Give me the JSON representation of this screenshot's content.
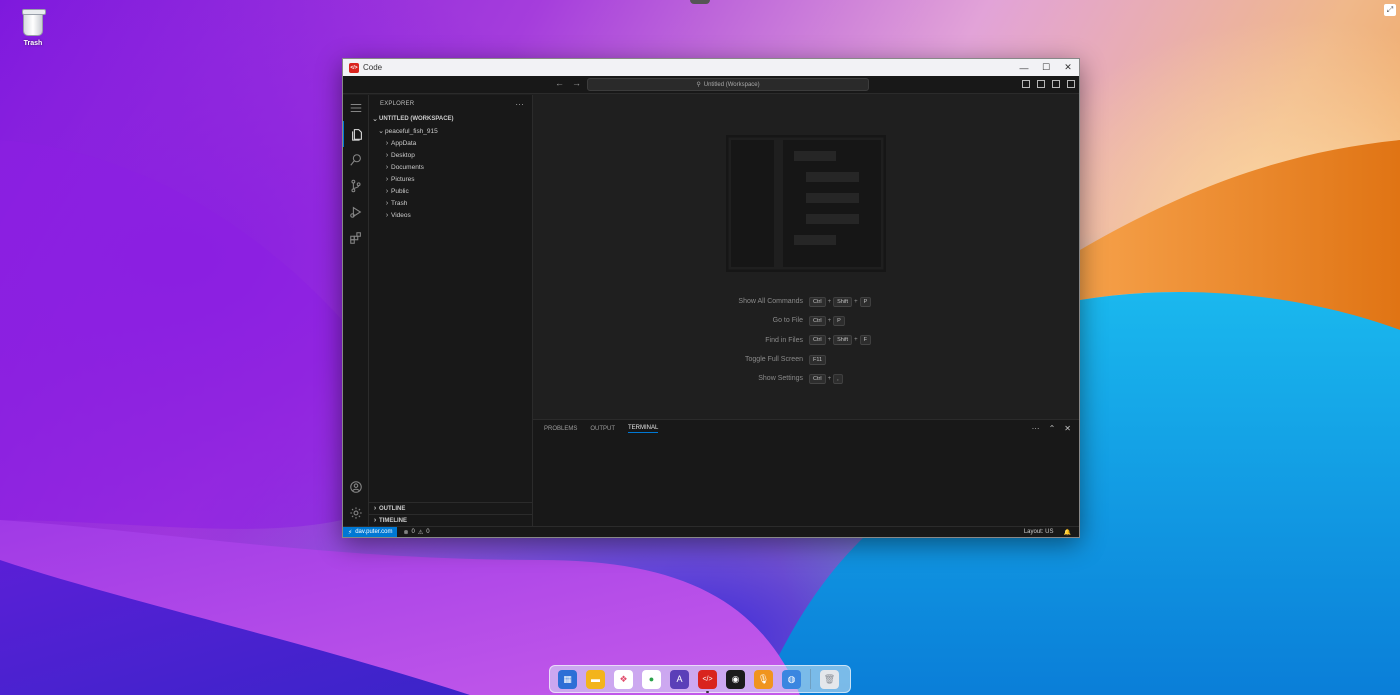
{
  "desktop": {
    "trash_label": "Trash"
  },
  "window": {
    "title": "Code",
    "controls": [
      "minimize",
      "maximize",
      "close"
    ]
  },
  "vscode": {
    "command_center": "Untitled (Workspace)",
    "activity_bar": [
      "explorer-icon",
      "search-icon",
      "source-control-icon",
      "run-debug-icon",
      "extensions-icon",
      "account-icon",
      "settings-gear-icon"
    ],
    "explorer": {
      "header": "EXPLORER",
      "more": "···",
      "workspace": "UNTITLED (WORKSPACE)",
      "root_folder": "peaceful_fish_915",
      "folders": [
        "AppData",
        "Desktop",
        "Documents",
        "Pictures",
        "Public",
        "Trash",
        "Videos"
      ],
      "outline": "OUTLINE",
      "timeline": "TIMELINE"
    },
    "hints": [
      {
        "label": "Show All Commands",
        "keys": [
          "Ctrl",
          "Shift",
          "P"
        ]
      },
      {
        "label": "Go to File",
        "keys": [
          "Ctrl",
          "P"
        ]
      },
      {
        "label": "Find in Files",
        "keys": [
          "Ctrl",
          "Shift",
          "F"
        ]
      },
      {
        "label": "Toggle Full Screen",
        "keys": [
          "F11"
        ]
      },
      {
        "label": "Show Settings",
        "keys": [
          "Ctrl",
          ","
        ]
      }
    ],
    "panel": {
      "tabs": [
        "PROBLEMS",
        "OUTPUT",
        "TERMINAL"
      ],
      "active_tab": "TERMINAL"
    },
    "status_bar": {
      "remote": "dav.puter.com",
      "errors": "0",
      "warnings": "0",
      "layout": "Layout: US"
    }
  },
  "dock": {
    "apps": [
      "app-grid-icon",
      "files-icon",
      "photos-icon",
      "paint-icon",
      "font-icon",
      "code-icon",
      "camera-icon",
      "recorder-icon",
      "browser-icon",
      "trash-icon"
    ],
    "colors": {
      "code": "#d9241e",
      "font": "#5b3fb8",
      "browser": "#3a86e0",
      "recorder": "#f0941e"
    }
  }
}
